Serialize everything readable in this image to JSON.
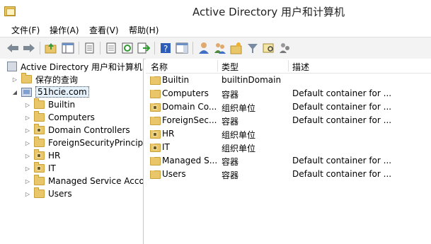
{
  "window": {
    "title": "Active Directory 用户和计算机"
  },
  "menu": [
    "文件(F)",
    "操作(A)",
    "查看(V)",
    "帮助(H)"
  ],
  "toolbar": {
    "buttons": [
      "back-icon",
      "forward-icon",
      "up-folder-icon",
      "console-tree-icon",
      "copy-icon",
      "properties-icon",
      "refresh-icon",
      "export-icon",
      "help-icon",
      "action-pane-icon",
      "new-user-icon",
      "new-group-icon",
      "new-ou-icon",
      "filter-icon",
      "find-icon",
      "delegate-icon"
    ]
  },
  "tree": {
    "root": "Active Directory 用户和计算机",
    "saved_queries": "保存的查询",
    "domain": "51hcie.com",
    "children": [
      "Builtin",
      "Computers",
      "Domain Controllers",
      "ForeignSecurityPrincipa",
      "HR",
      "IT",
      "Managed Service Acco",
      "Users"
    ]
  },
  "list": {
    "columns": [
      "名称",
      "类型",
      "描述"
    ],
    "rows": [
      {
        "name": "Builtin",
        "type": "builtinDomain",
        "desc": ""
      },
      {
        "name": "Computers",
        "type": "容器",
        "desc": "Default container for ..."
      },
      {
        "name": "Domain Co...",
        "type": "组织单位",
        "desc": "Default container for ..."
      },
      {
        "name": "ForeignSec...",
        "type": "容器",
        "desc": "Default container for ..."
      },
      {
        "name": "HR",
        "type": "组织单位",
        "desc": ""
      },
      {
        "name": "IT",
        "type": "组织单位",
        "desc": ""
      },
      {
        "name": "Managed S...",
        "type": "容器",
        "desc": "Default container for ..."
      },
      {
        "name": "Users",
        "type": "容器",
        "desc": "Default container for ..."
      }
    ]
  }
}
